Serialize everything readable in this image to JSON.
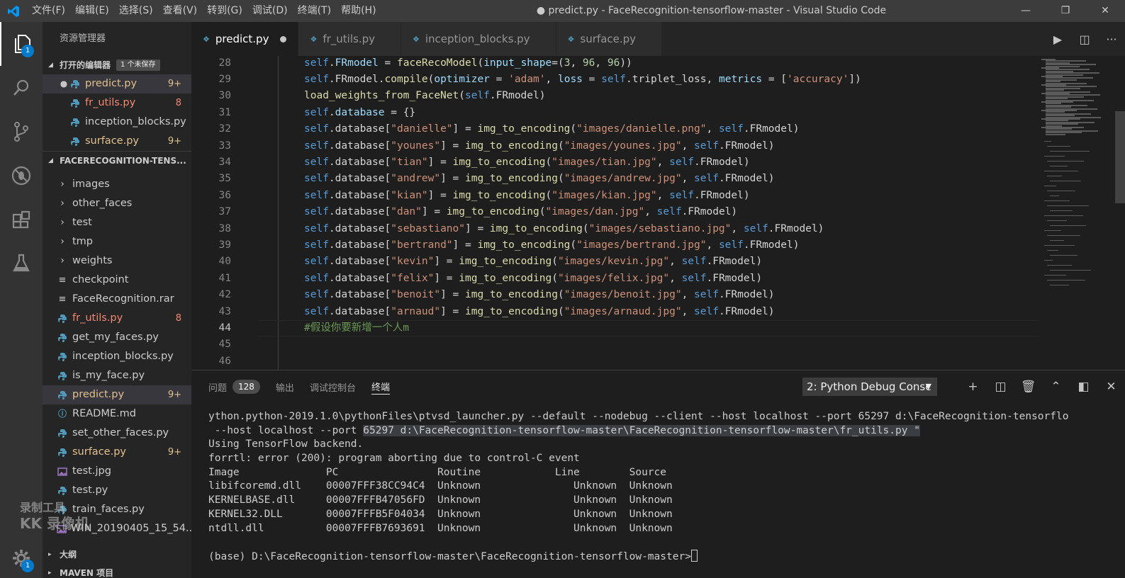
{
  "titlebar": {
    "menu": [
      "文件(F)",
      "编辑(E)",
      "选择(S)",
      "查看(V)",
      "转到(G)",
      "调试(D)",
      "终端(T)",
      "帮助(H)"
    ],
    "title": "● predict.py - FaceRecognition-tensorflow-master - Visual Studio Code",
    "minimize": "—",
    "restore": "❐",
    "close": "✕"
  },
  "activity": {
    "explorer_badge": "1",
    "settings_badge": "1"
  },
  "sidebar": {
    "header": "资源管理器",
    "open_editors_title": "打开的编辑器",
    "unsaved_label": "1 个未保存",
    "open_editors": [
      {
        "name": "predict.py",
        "count": "9+",
        "style": "mod",
        "dirty": "●"
      },
      {
        "name": "fr_utils.py",
        "count": "8",
        "style": "err",
        "dirty": ""
      },
      {
        "name": "inception_blocks.py",
        "count": "",
        "style": "",
        "dirty": ""
      },
      {
        "name": "surface.py",
        "count": "9+",
        "style": "mod",
        "dirty": ""
      }
    ],
    "project_title": "FACERECOGNITION-TENS...",
    "project_items": [
      {
        "name": "images",
        "type": "folder",
        "count": "",
        "style": ""
      },
      {
        "name": "other_faces",
        "type": "folder",
        "count": "",
        "style": ""
      },
      {
        "name": "test",
        "type": "folder",
        "count": "",
        "style": ""
      },
      {
        "name": "tmp",
        "type": "folder",
        "count": "",
        "style": ""
      },
      {
        "name": "weights",
        "type": "folder",
        "count": "",
        "style": ""
      },
      {
        "name": "checkpoint",
        "type": "file",
        "count": "",
        "style": ""
      },
      {
        "name": "FaceRecognition.rar",
        "type": "file",
        "count": "",
        "style": ""
      },
      {
        "name": "fr_utils.py",
        "type": "py",
        "count": "8",
        "style": "err"
      },
      {
        "name": "get_my_faces.py",
        "type": "py",
        "count": "",
        "style": ""
      },
      {
        "name": "inception_blocks.py",
        "type": "py",
        "count": "",
        "style": ""
      },
      {
        "name": "is_my_face.py",
        "type": "py",
        "count": "",
        "style": ""
      },
      {
        "name": "predict.py",
        "type": "py",
        "count": "9+",
        "style": "mod"
      },
      {
        "name": "README.md",
        "type": "md",
        "count": "",
        "style": ""
      },
      {
        "name": "set_other_faces.py",
        "type": "py",
        "count": "",
        "style": ""
      },
      {
        "name": "surface.py",
        "type": "py",
        "count": "9+",
        "style": "mod"
      },
      {
        "name": "test.jpg",
        "type": "img",
        "count": "",
        "style": ""
      },
      {
        "name": "test.py",
        "type": "py",
        "count": "",
        "style": ""
      },
      {
        "name": "train_faces.py",
        "type": "py",
        "count": "",
        "style": ""
      },
      {
        "name": "WIN_20190405_15_54...",
        "type": "img",
        "count": "",
        "style": ""
      }
    ],
    "outline_title": "大纲",
    "maven_title": "MAVEN 项目"
  },
  "tabs": [
    {
      "label": "predict.py",
      "active": true,
      "dirty": true
    },
    {
      "label": "fr_utils.py",
      "active": false,
      "dirty": false
    },
    {
      "label": "inception_blocks.py",
      "active": false,
      "dirty": false
    },
    {
      "label": "surface.py",
      "active": false,
      "dirty": false
    }
  ],
  "editor": {
    "current_line": "44",
    "lines": [
      {
        "n": "28",
        "code": "self.FRmodel = faceRecoModel(input_shape=(3, 96, 96))"
      },
      {
        "n": "29",
        "code": "self.FRmodel.compile(optimizer = 'adam', loss = self.triplet_loss, metrics = ['accuracy'])"
      },
      {
        "n": "30",
        "code": "load_weights_from_FaceNet(self.FRmodel)"
      },
      {
        "n": "31",
        "code": "self.database = {}"
      },
      {
        "n": "32",
        "code": "self.database[\"danielle\"] = img_to_encoding(\"images/danielle.png\", self.FRmodel)"
      },
      {
        "n": "33",
        "code": "self.database[\"younes\"] = img_to_encoding(\"images/younes.jpg\", self.FRmodel)"
      },
      {
        "n": "34",
        "code": "self.database[\"tian\"] = img_to_encoding(\"images/tian.jpg\", self.FRmodel)"
      },
      {
        "n": "35",
        "code": "self.database[\"andrew\"] = img_to_encoding(\"images/andrew.jpg\", self.FRmodel)"
      },
      {
        "n": "36",
        "code": "self.database[\"kian\"] = img_to_encoding(\"images/kian.jpg\", self.FRmodel)"
      },
      {
        "n": "37",
        "code": "self.database[\"dan\"] = img_to_encoding(\"images/dan.jpg\", self.FRmodel)"
      },
      {
        "n": "38",
        "code": "self.database[\"sebastiano\"] = img_to_encoding(\"images/sebastiano.jpg\", self.FRmodel)"
      },
      {
        "n": "39",
        "code": "self.database[\"bertrand\"] = img_to_encoding(\"images/bertrand.jpg\", self.FRmodel)"
      },
      {
        "n": "40",
        "code": "self.database[\"kevin\"] = img_to_encoding(\"images/kevin.jpg\", self.FRmodel)"
      },
      {
        "n": "41",
        "code": "self.database[\"felix\"] = img_to_encoding(\"images/felix.jpg\", self.FRmodel)"
      },
      {
        "n": "42",
        "code": "self.database[\"benoit\"] = img_to_encoding(\"images/benoit.jpg\", self.FRmodel)"
      },
      {
        "n": "43",
        "code": "self.database[\"arnaud\"] = img_to_encoding(\"images/arnaud.jpg\", self.FRmodel)"
      },
      {
        "n": "44",
        "code": "#假设你要新增一个人m"
      },
      {
        "n": "45",
        "code": ""
      },
      {
        "n": "46",
        "code": ""
      }
    ]
  },
  "panel": {
    "tabs": [
      {
        "label": "问题",
        "count": "128",
        "active": false
      },
      {
        "label": "输出",
        "count": "",
        "active": false
      },
      {
        "label": "调试控制台",
        "count": "",
        "active": false
      },
      {
        "label": "终端",
        "count": "",
        "active": true
      }
    ],
    "terminal_select": "2: Python Debug Consc",
    "terminal_lines": [
      "ython.python-2019.1.0\\pythonFiles\\ptvsd_launcher.py --default --nodebug --client --host localhost --port 65297 d:\\FaceRecognition-tensorflo",
      " --host localhost --port 65297 d:\\FaceRecognition-tensorflow-master\\FaceRecognition-tensorflow-master\\fr_utils.py \"",
      "Using TensorFlow backend.",
      "forrtl: error (200): program aborting due to control-C event",
      "Image              PC                Routine            Line        Source",
      "libifcoremd.dll    00007FFF38CC94C4  Unknown               Unknown  Unknown",
      "KERNELBASE.dll     00007FFFB47056FD  Unknown               Unknown  Unknown",
      "KERNEL32.DLL       00007FFFB5F04034  Unknown               Unknown  Unknown",
      "ntdll.dll          00007FFFB7693691  Unknown               Unknown  Unknown",
      "",
      "(base) D:\\FaceRecognition-tensorflow-master\\FaceRecognition-tensorflow-master>"
    ],
    "highlight_prefix": " --host localhost --port ",
    "highlight_text": "65297 d:\\FaceRecognition-tensorflow-master\\FaceRecognition-tensorflow-master\\fr_utils.py \""
  },
  "watermark": {
    "line1": "录制工具",
    "line2": "KK 录像机"
  },
  "colors": {
    "accent": "#007acc",
    "modified": "#e2c08d",
    "error": "#f48771",
    "keyword": "#569cd6",
    "string": "#ce9178",
    "function": "#dcdcaa",
    "comment": "#6a9955"
  }
}
